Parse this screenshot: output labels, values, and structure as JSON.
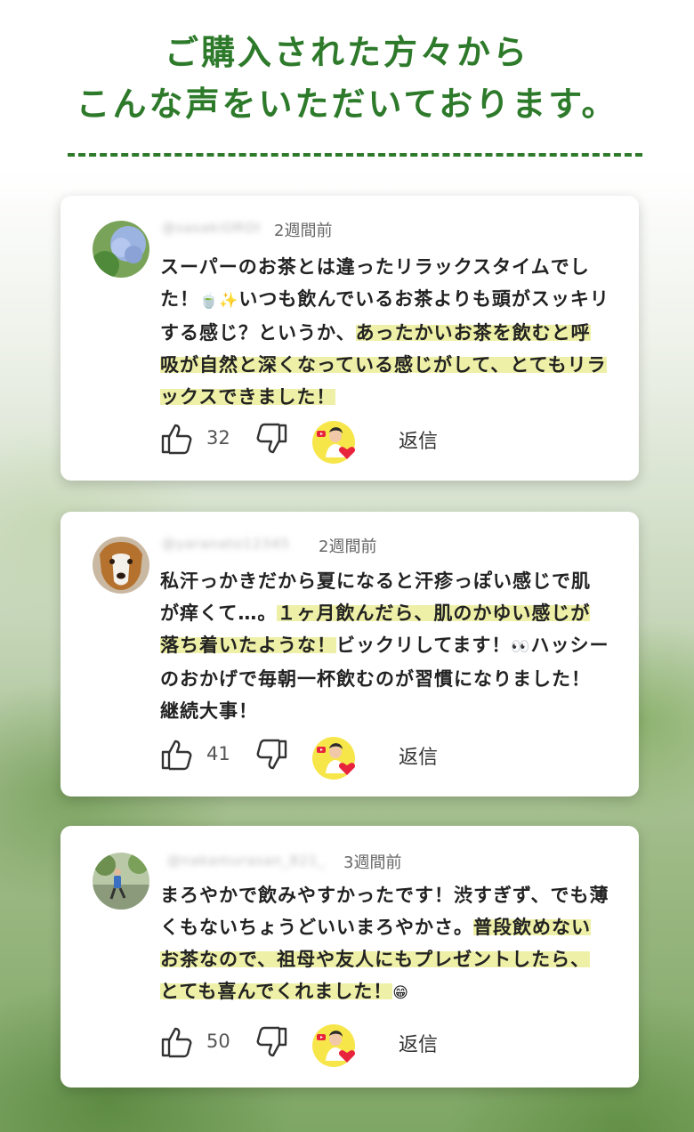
{
  "header": {
    "line1": "ご購入された方々から",
    "line2": "こんな声をいただいております。"
  },
  "colors": {
    "heading": "#2e7a2b",
    "highlight": "#eef0a8",
    "heart": "#e8243c"
  },
  "comments": [
    {
      "username": "@sasakiOROI",
      "time": "2週間前",
      "avatar": "hydrangea-photo",
      "text_1": "スーパーのお茶とは違ったリラックスタイムでした！",
      "emoji_1": "🍵✨",
      "text_2": "いつも飲んでいるお茶よりも頭がスッキリする感じ？というか、",
      "highlight": "あったかいお茶を飲むと呼吸が自然と深くなっている感じがして、とてもリラックスできました！",
      "likes": "32",
      "reply": "返信"
    },
    {
      "username": "@yaranato12345",
      "time": "2週間前",
      "avatar": "dog-photo",
      "text_1": "私汗っかきだから夏になると汗疹っぽい感じで肌が痒くて…。",
      "highlight": "１ヶ月飲んだら、肌のかゆい感じが落ち着いたような！",
      "text_2": "ビックリしてます！",
      "emoji_1": "👀",
      "text_3": "ハッシーのおかげで毎朝一杯飲むのが習慣になりました！継続大事！",
      "likes": "41",
      "reply": "返信"
    },
    {
      "username": "@nakamurasan_821_",
      "time": "3週間前",
      "avatar": "runner-photo",
      "text_1": "まろやかで飲みやすかったです！渋すぎず、でも薄くもないちょうどいいまろやかさ。",
      "highlight": "普段飲めないお茶なので、祖母や友人にもプレゼントしたら、とても喜んでくれました！",
      "emoji_1": "😁",
      "likes": "50",
      "reply": "返信"
    }
  ],
  "icons": {
    "like": "thumbs-up-icon",
    "dislike": "thumbs-down-icon",
    "creator": "creator-heart-badge"
  }
}
